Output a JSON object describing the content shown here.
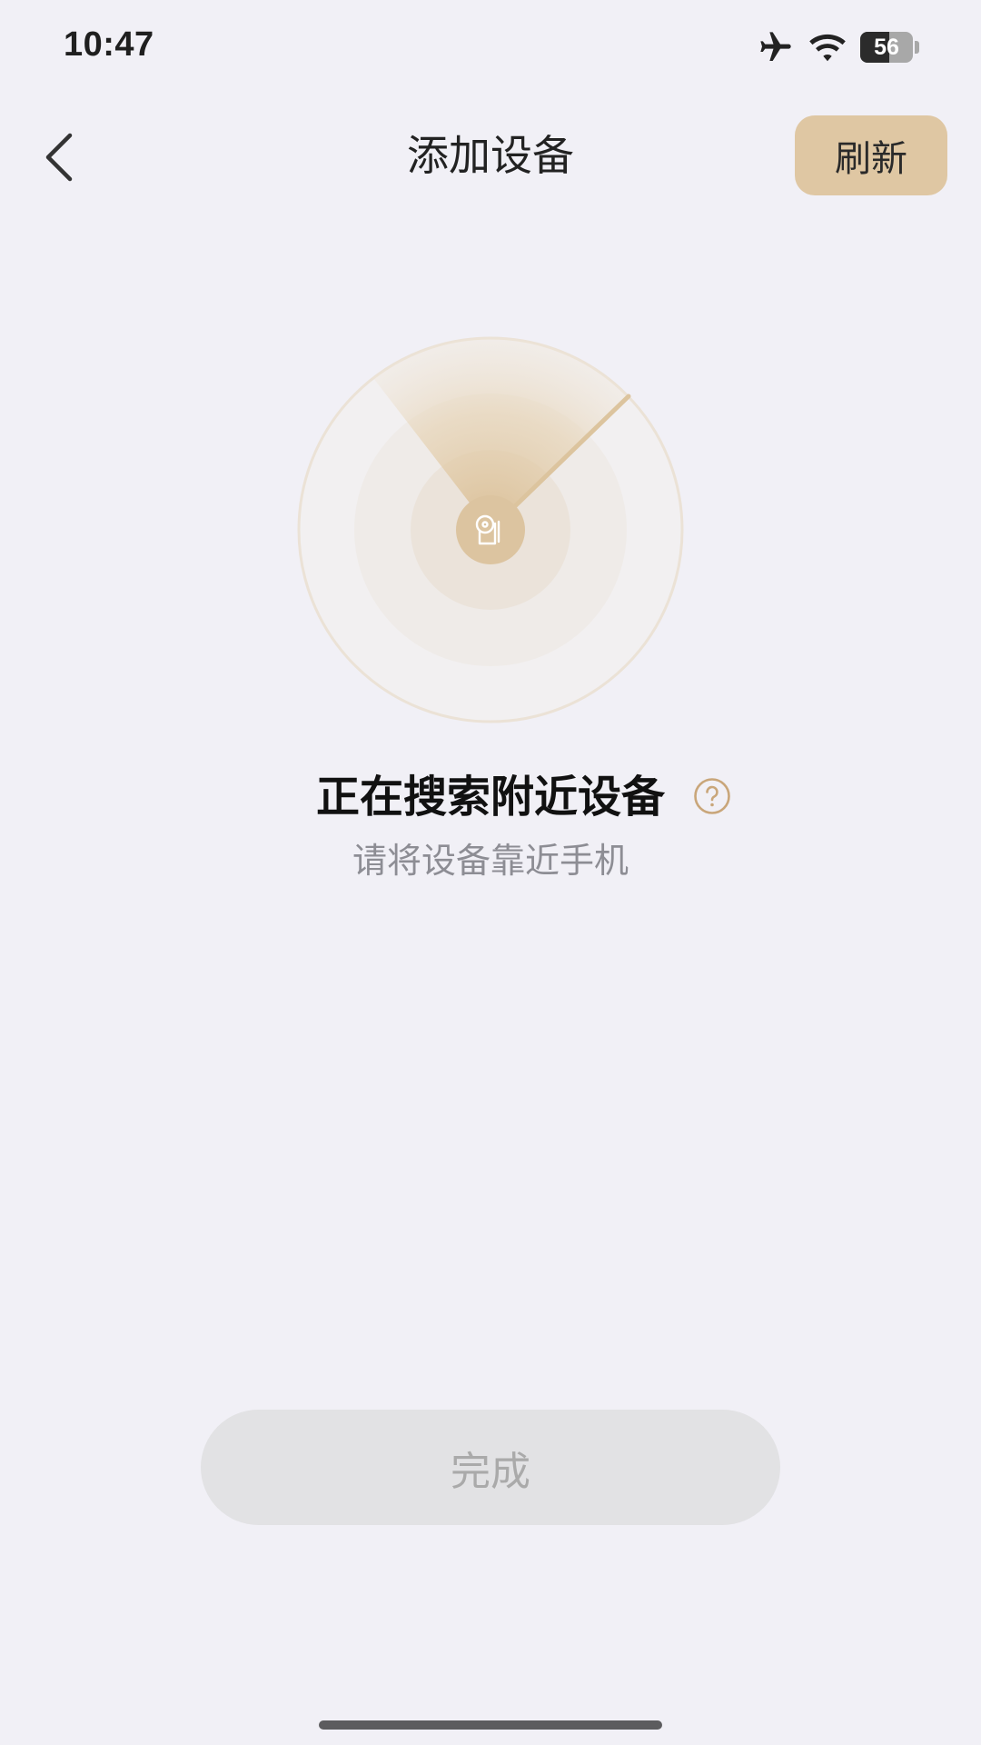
{
  "status_bar": {
    "time": "10:47",
    "battery_level": "56",
    "icons": [
      "airplane-icon",
      "wifi-icon",
      "battery-icon"
    ]
  },
  "nav": {
    "back_icon": "chevron-left-icon",
    "title": "添加设备",
    "refresh_label": "刷新"
  },
  "radar": {
    "center_icon": "device-icon",
    "accent": "#D8B98A"
  },
  "search": {
    "title": "正在搜索附近设备",
    "help_icon": "question-circle-icon",
    "subtitle": "请将设备靠近手机"
  },
  "footer": {
    "done_label": "完成"
  },
  "colors": {
    "background": "#F1F0F6",
    "accent": "#DFC7A3",
    "disabled_button": "#E2E2E4"
  }
}
